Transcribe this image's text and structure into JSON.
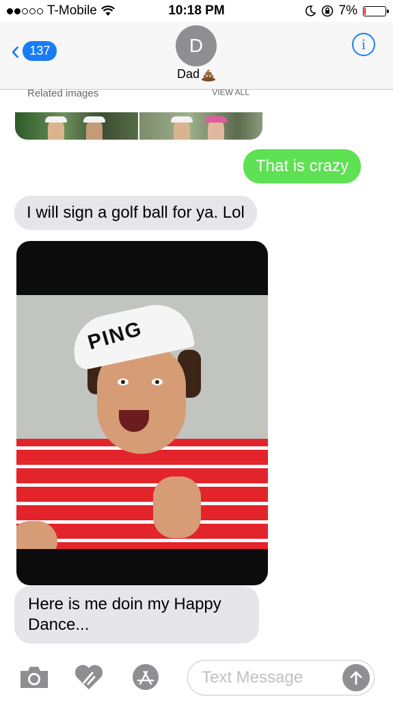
{
  "status": {
    "carrier": "T-Mobile",
    "time": "10:18 PM",
    "battery": "7%",
    "battery_level": 0.07,
    "signal_bars_filled": 2,
    "signal_bars_total": 5
  },
  "header": {
    "back_badge": "137",
    "avatar_initial": "D",
    "contact_name": "Dad",
    "contact_icon": "poop-emoji-icon",
    "info_label": "i"
  },
  "related": {
    "label": "Related images",
    "view_all": "VIEW ALL"
  },
  "messages": [
    {
      "type": "sent",
      "text": "That is crazy"
    },
    {
      "type": "received",
      "text": "I will sign a golf ball for ya. Lol"
    },
    {
      "type": "received",
      "text": "Here is me doin my Happy Dance..."
    }
  ],
  "photo": {
    "visor_brand": "PING"
  },
  "composer": {
    "placeholder": "Text Message"
  },
  "colors": {
    "accent": "#1a7cf5",
    "sent_bubble": "#5ee153",
    "received_bubble": "#e5e5ea"
  }
}
